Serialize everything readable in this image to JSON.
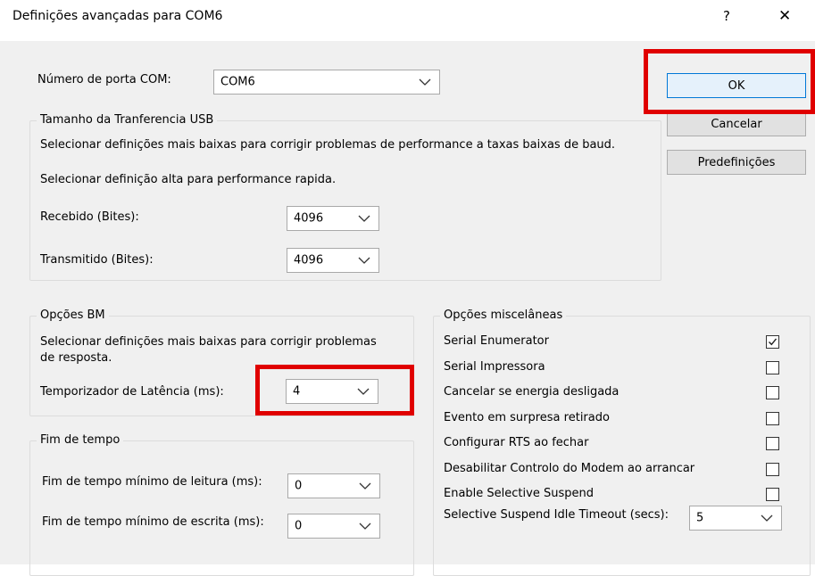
{
  "window": {
    "title": "Definições avançadas para COM6",
    "help_glyph": "?",
    "close_glyph": "✕"
  },
  "port": {
    "label": "Número de porta COM:",
    "value": "COM6"
  },
  "usb": {
    "legend": "Tamanho da Tranferencia USB",
    "line1": "Selecionar definições mais baixas para corrigir problemas de performance a taxas baixas de baud.",
    "line2": "Selecionar definição alta para performance rapida.",
    "rx_label": "Recebido (Bites):",
    "rx_value": "4096",
    "tx_label": "Transmitido (Bites):",
    "tx_value": "4096"
  },
  "bm": {
    "legend": "Opções BM",
    "desc1": "Selecionar definições mais baixas para corrigir problemas",
    "desc2": "de resposta.",
    "latency_label": "Temporizador de Latência (ms):",
    "latency_value": "4"
  },
  "timeouts": {
    "legend": "Fim de tempo",
    "read_label": "Fim de tempo mínimo de leitura (ms):",
    "read_value": "0",
    "write_label": "Fim de tempo mínimo de escrita (ms):",
    "write_value": "0"
  },
  "misc": {
    "legend": "Opções miscelâneas",
    "options": [
      {
        "label": "Serial Enumerator",
        "checked": true
      },
      {
        "label": "Serial Impressora",
        "checked": false
      },
      {
        "label": "Cancelar se energia desligada",
        "checked": false
      },
      {
        "label": "Evento em surpresa retirado",
        "checked": false
      },
      {
        "label": "Configurar RTS ao fechar",
        "checked": false
      },
      {
        "label": "Desabilitar Controlo do Modem ao arrancar",
        "checked": false
      },
      {
        "label": "Enable Selective Suspend",
        "checked": false
      }
    ],
    "idle_label": "Selective Suspend Idle Timeout (secs):",
    "idle_value": "5"
  },
  "buttons": {
    "ok": "OK",
    "cancel": "Cancelar",
    "defaults": "Predefinições"
  },
  "colors": {
    "highlight": "#e00000",
    "default_button_border": "#0078d7",
    "dialog_background": "#f0f0f0"
  },
  "icons": {
    "dropdown": "chevron-down-icon",
    "checkmark": "checkmark-icon",
    "close": "close-icon",
    "help": "help-icon"
  }
}
